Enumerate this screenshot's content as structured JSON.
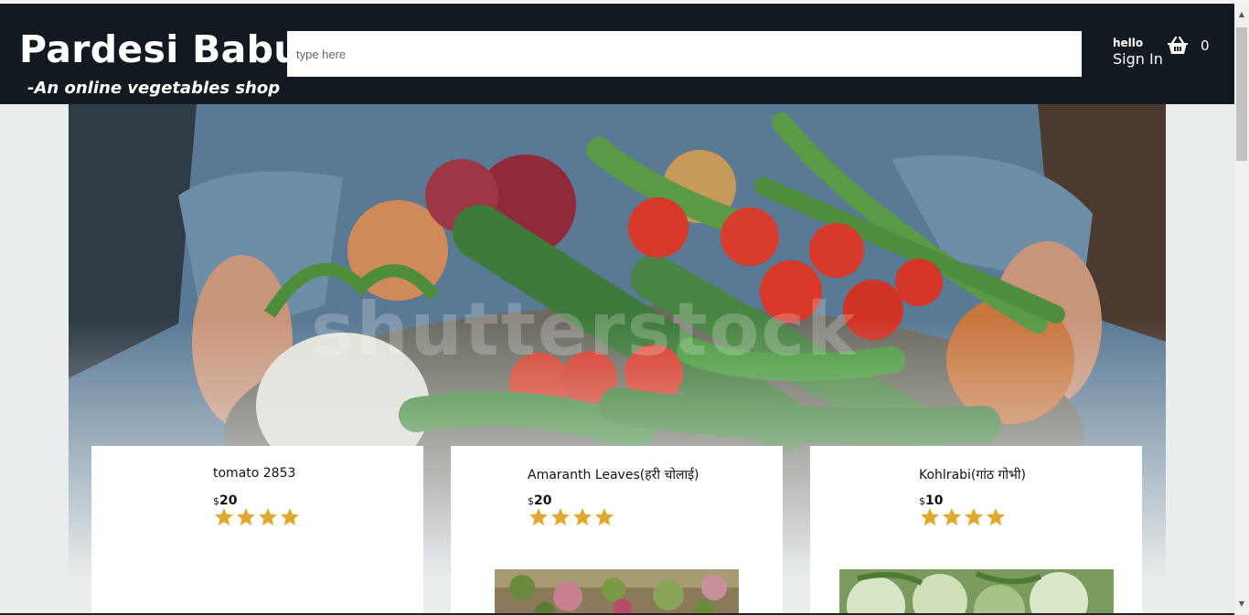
{
  "header": {
    "brand": "Pardesi Babu",
    "tagline": "-An online vegetables shop",
    "search_placeholder": "type here",
    "nav_greeting": "hello",
    "nav_signin": "Sign In",
    "basket_count": "0"
  },
  "hero": {
    "watermark_text": "shutterstock"
  },
  "products": [
    {
      "title": "tomato 2853",
      "currency": "$",
      "price": "20",
      "rating": 4,
      "has_image": false
    },
    {
      "title": "Amaranth Leaves(हरी चोलाई)",
      "currency": "$",
      "price": "20",
      "rating": 4,
      "has_image": true
    },
    {
      "title": "Kohlrabi(गांठ गोभी)",
      "currency": "$",
      "price": "10",
      "rating": 4,
      "has_image": true
    }
  ],
  "colors": {
    "header_bg": "#131921",
    "page_bg": "#eaeded",
    "star": "#e0a82e"
  },
  "icons": {
    "basket": "shopping-basket-icon",
    "star": "star-icon"
  }
}
